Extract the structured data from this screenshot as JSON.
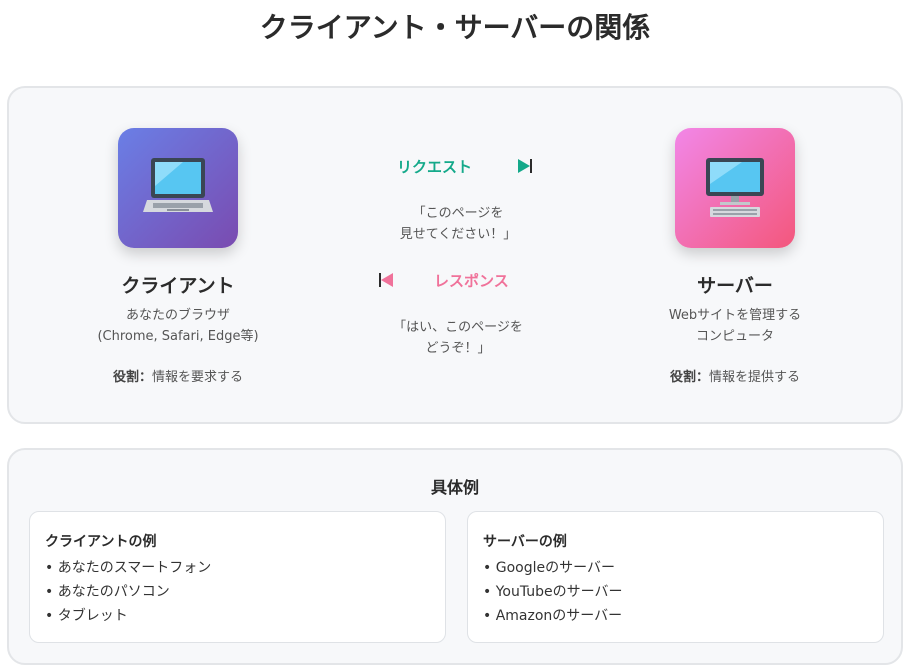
{
  "title": "クライアント・サーバーの関係",
  "client": {
    "icon": "laptop-icon",
    "name": "クライアント",
    "desc_line1": "あなたのブラウザ",
    "desc_line2": "(Chrome, Safari, Edge等)",
    "role_label": "役割：",
    "role_text": "情報を要求する"
  },
  "server": {
    "icon": "desktop-computer-icon",
    "name": "サーバー",
    "desc_line1": "Webサイトを管理する",
    "desc_line2": "コンピュータ",
    "role_label": "役割：",
    "role_text": "情報を提供する"
  },
  "request": {
    "label": "リクエスト",
    "message_line1": "「このページを",
    "message_line2": "見せてください！」",
    "color": "#14a98a"
  },
  "response": {
    "label": "レスポンス",
    "message_line1": "「はい、このページを",
    "message_line2": "どうぞ！」",
    "color": "#f0729a"
  },
  "examples": {
    "title": "具体例",
    "client_card": {
      "title": "クライアントの例",
      "items": [
        "あなたのスマートフォン",
        "あなたのパソコン",
        "タブレット"
      ]
    },
    "server_card": {
      "title": "サーバーの例",
      "items": [
        "Googleのサーバー",
        "YouTubeのサーバー",
        "Amazonのサーバー"
      ]
    }
  }
}
